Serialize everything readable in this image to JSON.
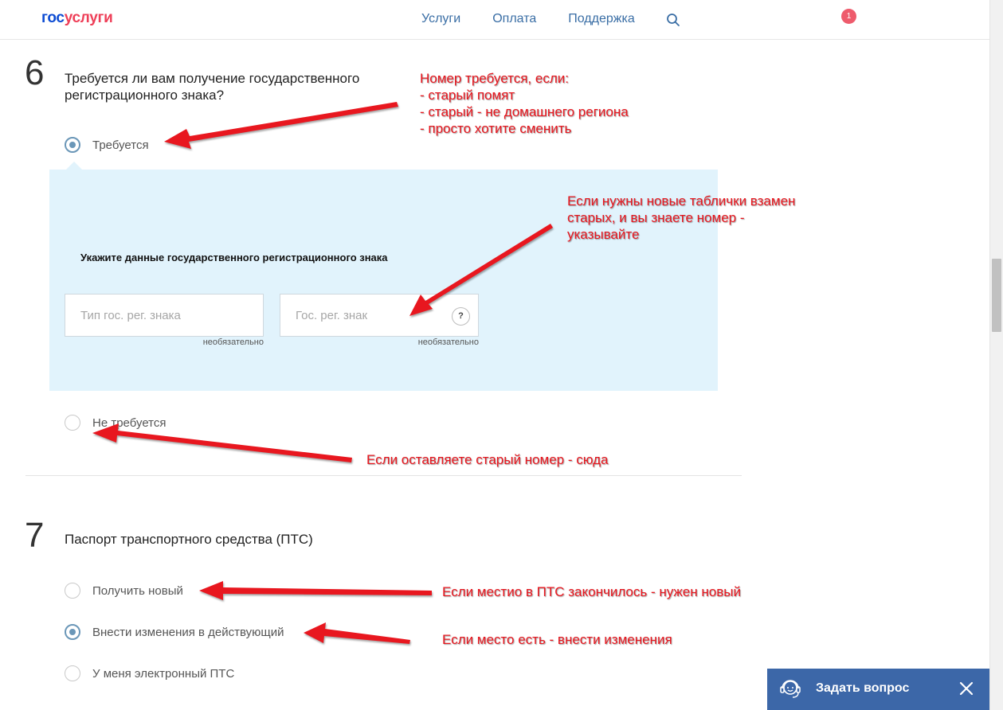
{
  "header": {
    "logo_part1": "гос",
    "logo_part2": "услуги",
    "nav": [
      "Услуги",
      "Оплата",
      "Поддержка"
    ],
    "notifications_count": "1"
  },
  "question6": {
    "number": "6",
    "title_line1": "Требуется ли вам получение государственного",
    "title_line2": "регистрационного знака?",
    "option_required": "Требуется",
    "option_not_required": "Не требуется",
    "selected": "Требуется",
    "panel_title": "Укажите данные государственного регистрационного знака",
    "field_type_placeholder": "Тип гос. рег. знака",
    "field_number_placeholder": "Гос. рег. знак",
    "field_type_value": "",
    "field_number_value": "",
    "optional_hint": "необязательно",
    "help_glyph": "?"
  },
  "question7": {
    "number": "7",
    "title": "Паспорт транспортного средства (ПТС)",
    "options": [
      "Получить новый",
      "Внести изменения в действующий",
      "У меня электронный ПТС"
    ],
    "selected": "Внести изменения в действующий"
  },
  "annotations": {
    "a1": "Номер требуется, если:\n- старый помят\n- старый - не домашнего региона\n- просто хотите сменить",
    "a2": "Если нужны новые таблички взамен\nстарых, и вы знаете номер -\nуказывайте",
    "a3": "Если оставляете старый номер - сюда",
    "a4": "Если местио в ПТС закончилось - нужен новый",
    "a5": "Если место есть - внести изменения"
  },
  "widget": {
    "ask_label": "Задать вопрос"
  },
  "colors": {
    "logo_blue": "#0d4cd3",
    "logo_red": "#ee3f58",
    "nav_link": "#3a6ea5",
    "panel_bg": "#e1f3fc",
    "radio_checked": "#6b97b8",
    "annotation_red": "#e8171f",
    "widget_bg": "#3c67a8",
    "badge": "#ee5b6c"
  }
}
